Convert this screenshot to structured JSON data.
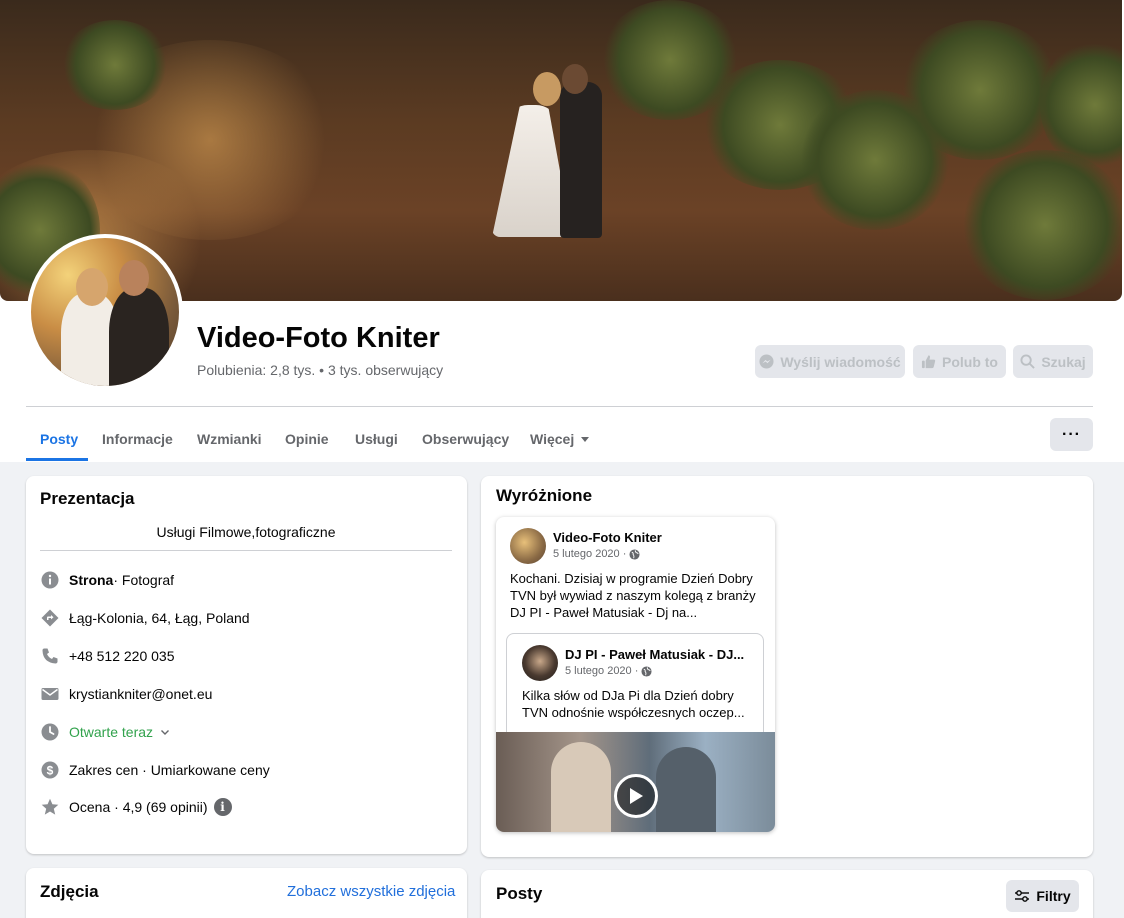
{
  "page": {
    "name": "Video-Foto Kniter",
    "stats": "Polubienia: 2,8 tys. • 3 tys. obserwujący"
  },
  "header_buttons": {
    "message": "Wyślij wiadomość",
    "like": "Polub to",
    "search": "Szukaj"
  },
  "tabs": [
    {
      "label": "Posty",
      "active": true
    },
    {
      "label": "Informacje"
    },
    {
      "label": "Wzmianki"
    },
    {
      "label": "Opinie"
    },
    {
      "label": "Usługi"
    },
    {
      "label": "Obserwujący"
    },
    {
      "label": "Więcej"
    }
  ],
  "more_button": "···",
  "intro": {
    "title": "Prezentacja",
    "bio": "Usługi Filmowe,fotograficzne",
    "category_strong": "Strona",
    "category_rest": " · Fotograf",
    "address": "Łąg-Kolonia, 64, Łąg, Poland",
    "phone": "+48 512 220 035",
    "email": "krystiankniter@onet.eu",
    "hours": "Otwarte teraz",
    "price": "Zakres cen · Umiarkowane ceny",
    "rating": "Ocena · 4,9 (69 opinii)",
    "rating_info": "i"
  },
  "photos": {
    "title": "Zdjęcia",
    "see_all": "Zobacz wszystkie zdjęcia"
  },
  "featured": {
    "title": "Wyróżnione",
    "post": {
      "author": "Video-Foto Kniter",
      "date": "5 lutego 2020 ·",
      "text": "Kochani. Dzisiaj w programie Dzień Dobry TVN był wywiad z naszym kolegą z branży DJ PI - Paweł Matusiak - Dj na...",
      "shared": {
        "author": "DJ PI - Paweł Matusiak - DJ...",
        "date": "5 lutego 2020 ·",
        "text": "Kilka słów od DJa Pi dla Dzień dobry TVN odnośnie współczesnych oczep..."
      }
    }
  },
  "posts": {
    "title": "Posty",
    "filter": "Filtry"
  },
  "colors": {
    "accent": "#1b74e4",
    "open_green": "#31a24c",
    "background": "#f0f2f5"
  }
}
